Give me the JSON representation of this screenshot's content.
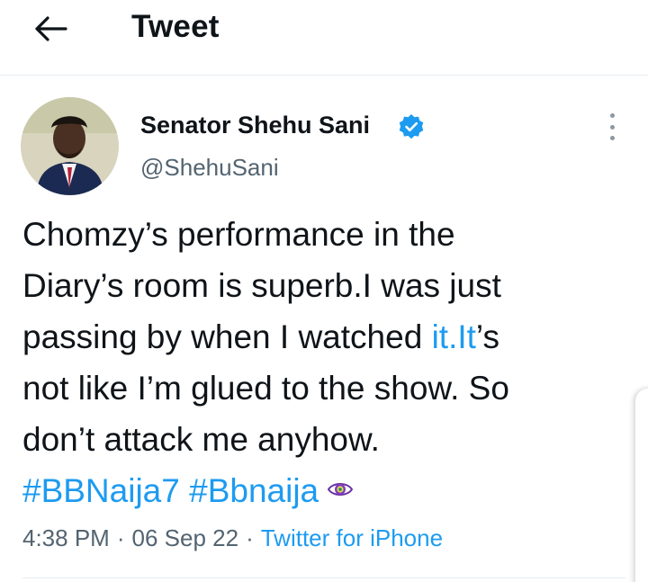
{
  "header": {
    "title": "Tweet"
  },
  "tweet": {
    "author_name": "Senator Shehu Sani",
    "author_handle": "@ShehuSani",
    "text_line_1": "Chomzy’s performance in the",
    "text_line_2": "Diary’s room is superb.I was just",
    "text_line_3_before": "passing by when I watched ",
    "text_line_3_link": "it.It",
    "text_line_3_after": "’s",
    "text_line_4": "not like I’m glued to the show. So",
    "text_line_5": "don’t attack me anyhow.",
    "hashtag_1": "#BBNaija7",
    "hashtag_2": "#Bbnaija",
    "time": "4:38 PM",
    "date": "06 Sep 22",
    "source": "Twitter for iPhone"
  },
  "icons": {
    "back": "arrow-left-icon",
    "verified": "verified-badge-icon",
    "more": "more-vertical-icon",
    "emoji": "eye-emoji-icon"
  },
  "colors": {
    "accent": "#1d9bf0",
    "text": "#0f1419",
    "secondary": "#536471"
  }
}
